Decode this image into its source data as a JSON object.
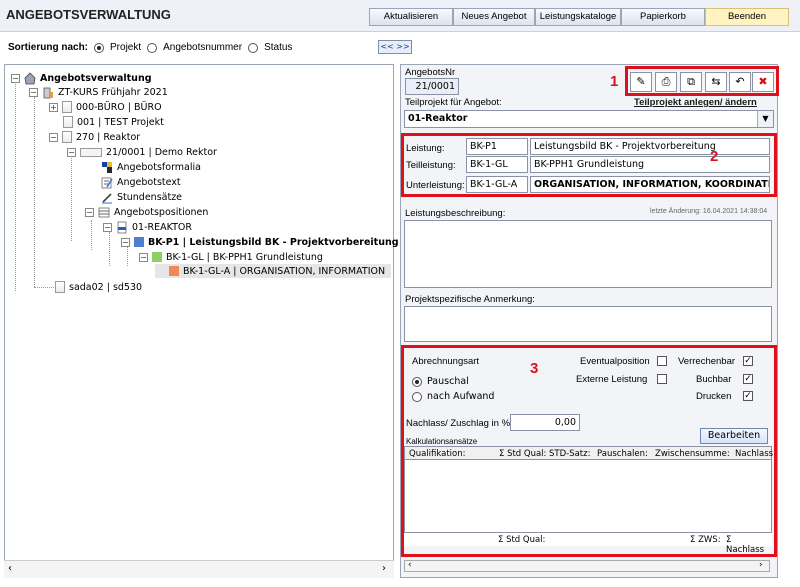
{
  "app": {
    "title": "ANGEBOTSVERWALTUNG"
  },
  "toolbar": {
    "aktualisieren": "Aktualisieren",
    "neues_angebot": "Neues Angebot",
    "leistungskataloge": "Leistungskataloge",
    "papierkorb": "Papierkorb",
    "beenden": "Beenden"
  },
  "sort": {
    "label": "Sortierung nach:",
    "options": [
      "Projekt",
      "Angebotsnummer",
      "Status"
    ],
    "selected": "Projekt"
  },
  "collapse_btn": "<< >>",
  "tree": {
    "root": "Angebotsverwaltung",
    "course": "ZT-KURS Frühjahr 2021",
    "n000": "000-BÜRO | BÜRO",
    "n001": "001 | TEST Projekt",
    "n270": "270 | Reaktor",
    "n21": "21/0001 | Demo Rektor",
    "formalia": "Angebotsformalia",
    "text": "Angebotstext",
    "stunden": "Stundensätze",
    "positionen": "Angebotspositionen",
    "reaktor": "01-REAKTOR",
    "bkp1": "BK-P1 | Leistungsbild BK - Projektvorbereitung",
    "bk1gl": "BK-1-GL | BK-PPH1 Grundleistung",
    "bk1gla": "BK-1-GL-A | ORGANISATION, INFORMATION",
    "sada": "sada02 | sd530"
  },
  "detail": {
    "angebotsnr_label": "AngebotsNr",
    "angebotsnr": "21/0001",
    "teilprojekt_label": "Teilprojekt für Angebot:",
    "teilprojekt_link": "Teilprojekt anlegen/ ändern",
    "teilprojekt_value": "01-Reaktor",
    "leistung_label": "Leistung:",
    "leistung_code": "BK-P1",
    "leistung_text": "Leistungsbild BK - Projektvorbereitung",
    "teilleistung_label": "Teilleistung:",
    "teilleistung_code": "BK-1-GL",
    "teilleistung_text": "BK-PPH1 Grundleistung",
    "unterleistung_label": "Unterleistung:",
    "unterleistung_code": "BK-1-GL-A",
    "unterleistung_text": "ORGANISATION, INFORMATION, KOORDINATION, DO",
    "letzte_aenderung": "letzte Änderung: 16.04.2021 14:38:04",
    "leistungsbeschreibung_label": "Leistungsbeschreibung:",
    "anmerkung_label": "Projektspezifische Anmerkung:",
    "abrechnungsart_label": "Abrechnungsart",
    "pauschal": "Pauschal",
    "nach_aufwand": "nach Aufwand",
    "eventualposition": "Eventualposition",
    "externe_leistung": "Externe Leistung",
    "verrechenbar": "Verrechenbar",
    "buchbar": "Buchbar",
    "drucken": "Drucken",
    "nachlass_label": "Nachlass/ Zuschlag in %:",
    "nachlass_value": "0,00",
    "kalkulation_label": "Kalkulationsansätze",
    "bearbeiten": "Bearbeiten",
    "columns": [
      "Qualifikation:",
      "Σ Std Qual:",
      "STD-Satz:",
      "Pauschalen:",
      "Zwischensumme:",
      "Nachlass"
    ],
    "footer_std": "Σ Std Qual:",
    "footer_zws": "Σ ZWS:",
    "footer_nachlass": "Σ Nachlass"
  },
  "annotations": {
    "one": "1",
    "two": "2",
    "three": "3"
  },
  "colors": {
    "accent_red": "#e0101a",
    "title_bg": "#eef2f8",
    "beenden_bg": "#fff3c2"
  }
}
